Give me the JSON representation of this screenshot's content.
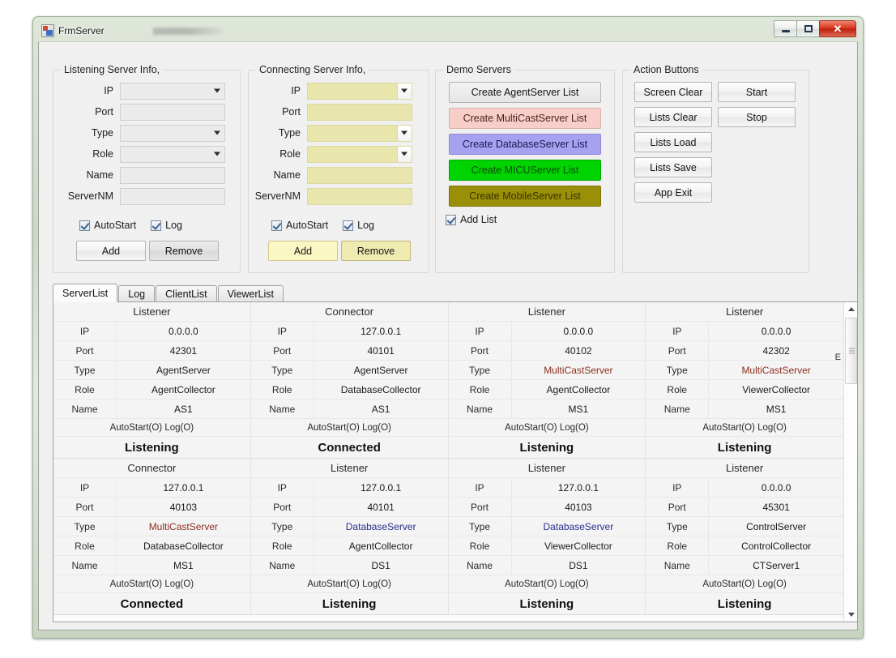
{
  "window": {
    "title": "FrmServer",
    "icon": "app-form-icon",
    "caption_buttons": [
      {
        "name": "minimize",
        "glyph": "minimize-icon"
      },
      {
        "name": "maximize",
        "glyph": "maximize-icon"
      },
      {
        "name": "close",
        "glyph": "✕"
      }
    ]
  },
  "listening_panel": {
    "title": "Listening Server Info,",
    "fields": [
      {
        "label": "IP",
        "value": "",
        "kind": "combo"
      },
      {
        "label": "Port",
        "value": "",
        "kind": "text"
      },
      {
        "label": "Type",
        "value": "",
        "kind": "combo"
      },
      {
        "label": "Role",
        "value": "",
        "kind": "combo"
      },
      {
        "label": "Name",
        "value": "",
        "kind": "text"
      },
      {
        "label": "ServerNM",
        "value": "",
        "kind": "text"
      }
    ],
    "autostart_label": "AutoStart",
    "autostart_checked": true,
    "log_label": "Log",
    "log_checked": true,
    "add_label": "Add",
    "remove_label": "Remove"
  },
  "connecting_panel": {
    "title": "Connecting Server Info,",
    "fields": [
      {
        "label": "IP",
        "value": "",
        "kind": "combo"
      },
      {
        "label": "Port",
        "value": "",
        "kind": "text"
      },
      {
        "label": "Type",
        "value": "",
        "kind": "combo"
      },
      {
        "label": "Role",
        "value": "",
        "kind": "combo"
      },
      {
        "label": "Name",
        "value": "",
        "kind": "text"
      },
      {
        "label": "ServerNM",
        "value": "",
        "kind": "text"
      }
    ],
    "autostart_label": "AutoStart",
    "autostart_checked": true,
    "log_label": "Log",
    "log_checked": true,
    "add_label": "Add",
    "remove_label": "Remove",
    "field_color": "#e8e6ad"
  },
  "demo_panel": {
    "title": "Demo Servers",
    "buttons": [
      {
        "label": "Create AgentServer List",
        "color": "#eeeeee"
      },
      {
        "label": "Create MultiCastServer List",
        "color": "#f8cfc8"
      },
      {
        "label": "Create DatabaseServer List",
        "color": "#a7a2f0"
      },
      {
        "label": "Create MICUServer List",
        "color": "#00d400"
      },
      {
        "label": "Create MobileServer List",
        "color": "#9a8f08"
      }
    ],
    "add_list_label": "Add List",
    "add_list_checked": true
  },
  "action_panel": {
    "title": "Action Buttons",
    "left_buttons": [
      "Screen Clear",
      "Lists Clear",
      "Lists Load",
      "Lists Save",
      "App Exit"
    ],
    "right_buttons": [
      "Start",
      "Stop"
    ]
  },
  "tabs": [
    {
      "label": "ServerList",
      "active": true
    },
    {
      "label": "Log",
      "active": false
    },
    {
      "label": "ClientList",
      "active": false
    },
    {
      "label": "ViewerList",
      "active": false
    }
  ],
  "grid": {
    "row_keys": [
      "IP",
      "Port",
      "Type",
      "Role",
      "Name"
    ],
    "rows": [
      [
        {
          "header": "Listener",
          "ip": "0.0.0.0",
          "port": "42301",
          "type": "AgentServer",
          "type_class": "type-agent",
          "role": "AgentCollector",
          "name": "AS1",
          "flags": "AutoStart(O)  Log(O)",
          "status": "Listening"
        },
        {
          "header": "Connector",
          "ip": "127.0.0.1",
          "port": "40101",
          "type": "AgentServer",
          "type_class": "type-agent",
          "role": "DatabaseCollector",
          "name": "AS1",
          "flags": "AutoStart(O)  Log(O)",
          "status": "Connected"
        },
        {
          "header": "Listener",
          "ip": "0.0.0.0",
          "port": "40102",
          "type": "MultiCastServer",
          "type_class": "type-multicast",
          "role": "AgentCollector",
          "name": "MS1",
          "flags": "AutoStart(O)  Log(O)",
          "status": "Listening"
        },
        {
          "header": "Listener",
          "ip": "0.0.0.0",
          "port": "42302",
          "type": "MultiCastServer",
          "type_class": "type-multicast",
          "role": "ViewerCollector",
          "name": "MS1",
          "flags": "AutoStart(O)  Log(O)",
          "status": "Listening"
        }
      ],
      [
        {
          "header": "Connector",
          "ip": "127.0.0.1",
          "port": "40103",
          "type": "MultiCastServer",
          "type_class": "type-multicast",
          "role": "DatabaseCollector",
          "name": "MS1",
          "flags": "AutoStart(O)  Log(O)",
          "status": "Connected"
        },
        {
          "header": "Listener",
          "ip": "127.0.0.1",
          "port": "40101",
          "type": "DatabaseServer",
          "type_class": "type-database",
          "role": "AgentCollector",
          "name": "DS1",
          "flags": "AutoStart(O)  Log(O)",
          "status": "Listening"
        },
        {
          "header": "Listener",
          "ip": "127.0.0.1",
          "port": "40103",
          "type": "DatabaseServer",
          "type_class": "type-database",
          "role": "ViewerCollector",
          "name": "DS1",
          "flags": "AutoStart(O)  Log(O)",
          "status": "Listening"
        },
        {
          "header": "Listener",
          "ip": "0.0.0.0",
          "port": "45301",
          "type": "ControlServer",
          "type_class": "type-control",
          "role": "ControlCollector",
          "name": "CTServer1",
          "flags": "AutoStart(O)  Log(O)",
          "status": "Listening"
        }
      ]
    ],
    "scroll_marker": "E"
  }
}
